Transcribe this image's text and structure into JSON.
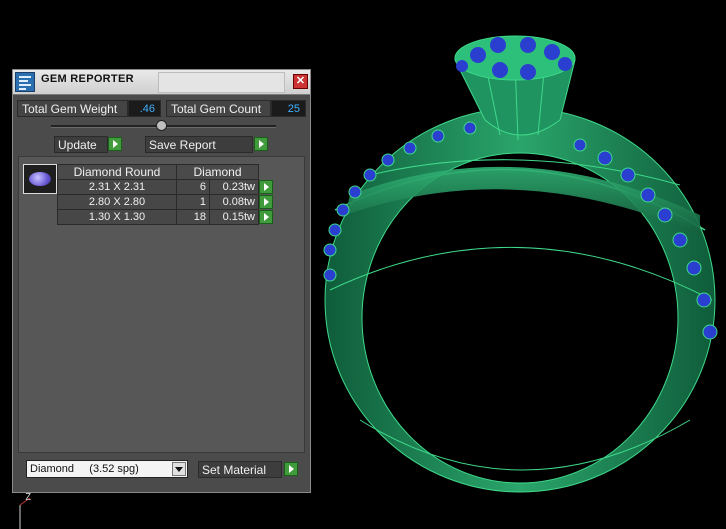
{
  "viewport": {
    "axis_label": "Z"
  },
  "panel": {
    "title": "GEM REPORTER",
    "close_symbol": "✕",
    "total_weight_label": "Total Gem Weight",
    "total_weight_value": ".46",
    "total_count_label": "Total Gem Count",
    "total_count_value": "25",
    "update_label": "Update",
    "save_report_label": "Save Report",
    "table": {
      "header_shape": "Diamond Round",
      "header_material": "Diamond",
      "rows": [
        {
          "size": "2.31 X 2.31",
          "count": "6",
          "weight": "0.23tw"
        },
        {
          "size": "2.80 X 2.80",
          "count": "1",
          "weight": "0.08tw"
        },
        {
          "size": "1.30 X 1.30",
          "count": "18",
          "weight": "0.15tw"
        }
      ]
    },
    "material_select": "Diamond     (3.52 spg)",
    "set_material_label": "Set Material"
  },
  "icons": {
    "app": "gem-reporter-icon",
    "close": "close-icon",
    "go": "green-play-arrow-icon",
    "gem": "round-gem-icon",
    "dropdown": "chevron-down-icon"
  },
  "colors": {
    "ring_green": "#1f8a5a",
    "wire_green": "#3fd98a",
    "gem_blue": "#2a3fd0",
    "value_blue": "#3fb0ff",
    "go_green": "#3f9b3c"
  }
}
